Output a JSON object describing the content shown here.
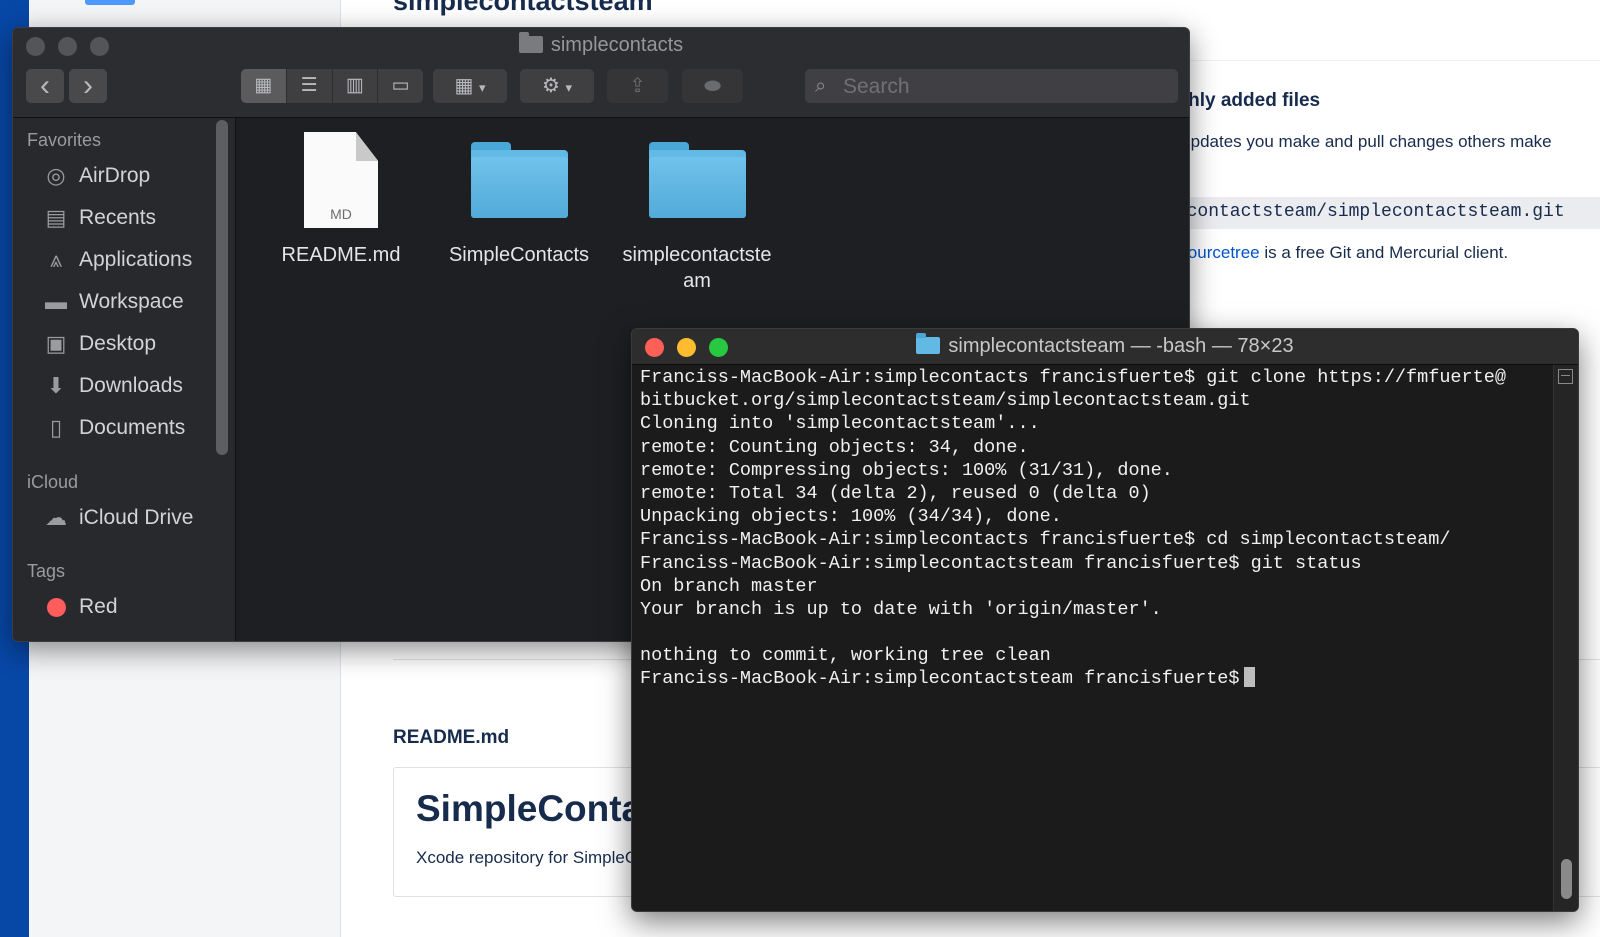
{
  "background_page": {
    "repo_title": "simplecontactsteam",
    "section_title": "eshly added files",
    "section_desc": "n updates you make and pull changes others make",
    "clone_url": "lecontactsteam/simplecontactsteam.git",
    "sourcetree_prefix": ". ",
    "sourcetree_link": "Sourcetree",
    "sourcetree_suffix": " is a free Git and Mercurial client.",
    "readme_label": "README.md",
    "readme_heading": "SimpleContacts",
    "readme_desc": "Xcode repository for SimpleContacts"
  },
  "finder": {
    "title": "simplecontacts",
    "search_placeholder": "Search",
    "nav": {
      "back": "‹",
      "forward": "›"
    },
    "sidebar": {
      "favorites_header": "Favorites",
      "favorites": [
        {
          "label": "AirDrop",
          "icon": "airdrop-icon"
        },
        {
          "label": "Recents",
          "icon": "recents-icon"
        },
        {
          "label": "Applications",
          "icon": "applications-icon"
        },
        {
          "label": "Workspace",
          "icon": "folder-icon"
        },
        {
          "label": "Desktop",
          "icon": "desktop-icon"
        },
        {
          "label": "Downloads",
          "icon": "downloads-icon"
        },
        {
          "label": "Documents",
          "icon": "documents-icon"
        }
      ],
      "icloud_header": "iCloud",
      "icloud": [
        {
          "label": "iCloud Drive",
          "icon": "cloud-icon"
        }
      ],
      "tags_header": "Tags",
      "tags": [
        {
          "label": "Red",
          "color": "#ff5c5c"
        }
      ]
    },
    "files": [
      {
        "name": "README.md",
        "kind": "document",
        "ext": "MD"
      },
      {
        "name": "SimpleContacts",
        "kind": "folder"
      },
      {
        "name_line1": "simplecontactste",
        "name_line2": "am",
        "kind": "folder"
      }
    ]
  },
  "terminal": {
    "title": "simplecontactsteam — -bash — 78×23",
    "lines": [
      "Franciss-MacBook-Air:simplecontacts francisfuerte$ git clone https://fmfuerte@",
      "bitbucket.org/simplecontactsteam/simplecontactsteam.git",
      "Cloning into 'simplecontactsteam'...",
      "remote: Counting objects: 34, done.",
      "remote: Compressing objects: 100% (31/31), done.",
      "remote: Total 34 (delta 2), reused 0 (delta 0)",
      "Unpacking objects: 100% (34/34), done.",
      "Franciss-MacBook-Air:simplecontacts francisfuerte$ cd simplecontactsteam/",
      "Franciss-MacBook-Air:simplecontactsteam francisfuerte$ git status",
      "On branch master",
      "Your branch is up to date with 'origin/master'.",
      "",
      "nothing to commit, working tree clean",
      "Franciss-MacBook-Air:simplecontactsteam francisfuerte$"
    ]
  },
  "colors": {
    "finder_bg": "#1e1f22",
    "terminal_bg": "#1b1b1b",
    "folder_blue": "#62b9e4",
    "link_blue": "#0052cc"
  }
}
